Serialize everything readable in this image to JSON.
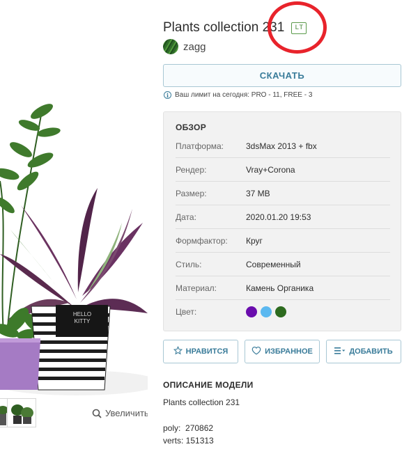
{
  "model": {
    "title": "Plants collection 231",
    "badge": "LT",
    "author": "zagg"
  },
  "download": {
    "label": "СКАЧАТЬ",
    "limit_text": "Ваш лимит на сегодня: PRO - 11, FREE - 3"
  },
  "overview": {
    "heading": "ОБЗОР",
    "specs": [
      {
        "key": "Платформа:",
        "value": "3dsMax 2013 + fbx"
      },
      {
        "key": "Рендер:",
        "value": "Vray+Corona"
      },
      {
        "key": "Размер:",
        "value": "37 MB"
      },
      {
        "key": "Дата:",
        "value": "2020.01.20 19:53"
      },
      {
        "key": "Формфактор:",
        "value": "Круг"
      },
      {
        "key": "Стиль:",
        "value": "Современный"
      },
      {
        "key": "Материал:",
        "value": "Камень Органика"
      }
    ],
    "color_label": "Цвет:",
    "colors": [
      "#6a0dad",
      "#5bb8f0",
      "#2d6b1f"
    ]
  },
  "actions": {
    "like": "НРАВИТСЯ",
    "favorite": "ИЗБРАННОЕ",
    "add": "ДОБАВИТЬ"
  },
  "description": {
    "heading": "ОПИСАНИЕ МОДЕЛИ",
    "name": "Plants collection 231",
    "poly": "poly:  270862",
    "verts": "verts: 151313"
  },
  "preview": {
    "zoom_label": "Увеличить",
    "pot_label_line1": "HELLO",
    "pot_label_line2": "KITTY"
  },
  "icons": {
    "info": "info-icon",
    "star": "star-icon",
    "heart": "heart-icon",
    "add_list": "add-to-list-icon",
    "zoom": "magnifier-icon"
  }
}
